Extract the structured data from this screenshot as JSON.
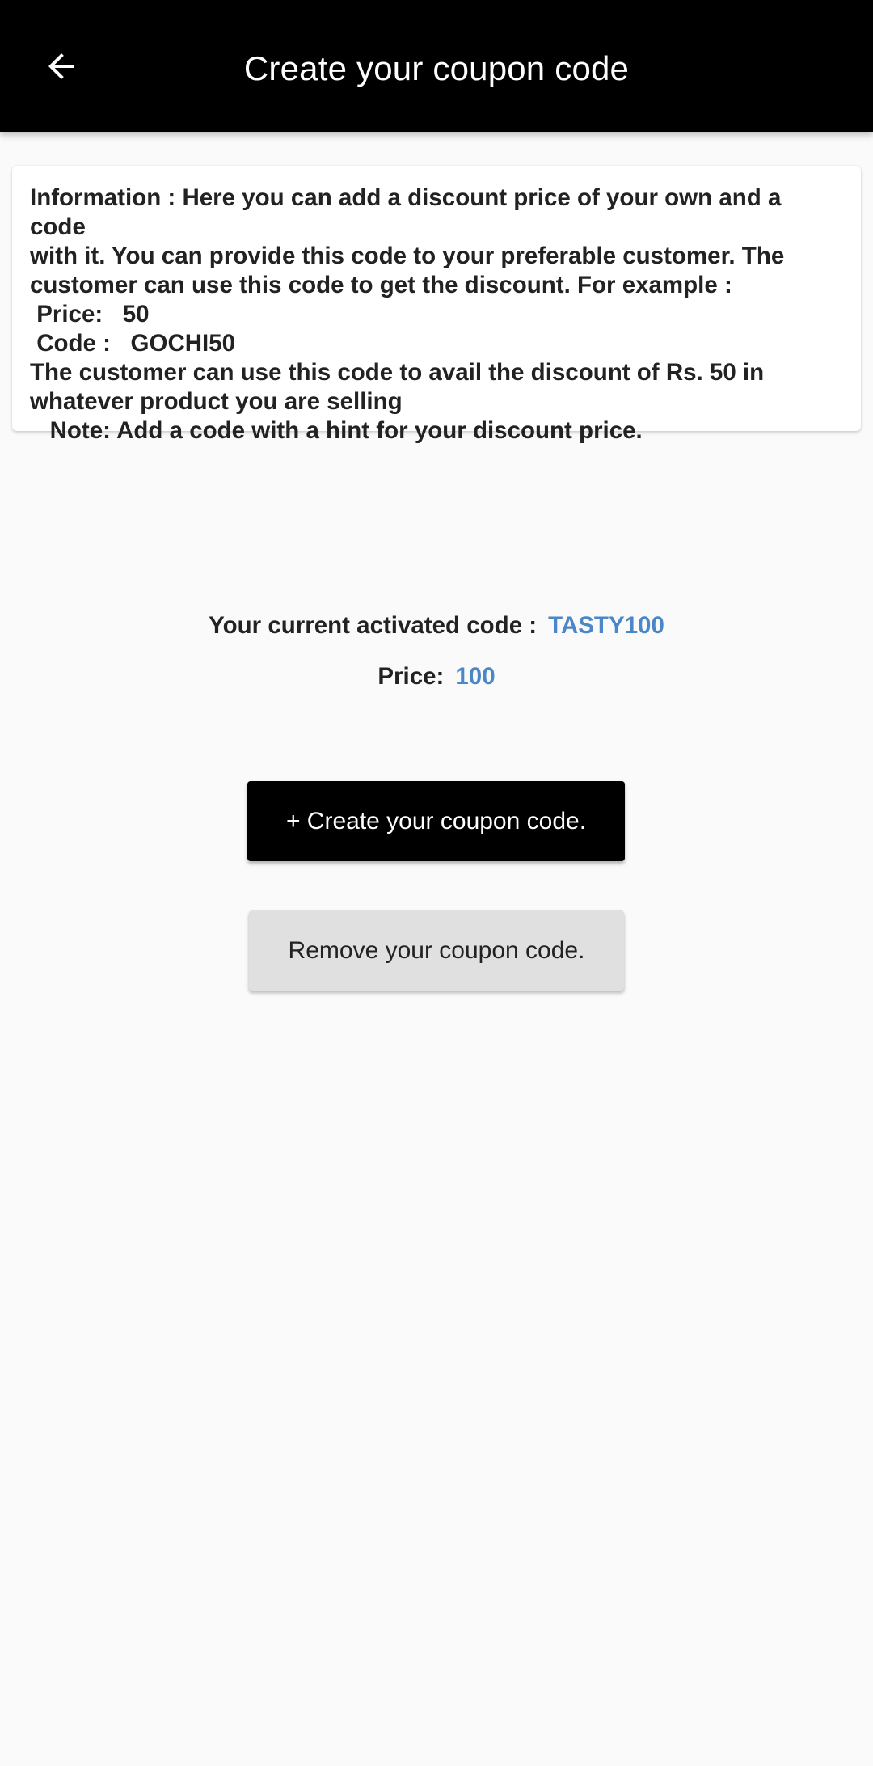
{
  "app_bar": {
    "title": "Create your coupon code",
    "back_icon": "arrow-left-icon"
  },
  "info_card": {
    "lines": [
      "Information : Here you can add a discount price of your own and a code",
      "with it. You can provide this code to your preferable customer. The",
      "customer can use this code to get the discount. For example :",
      " Price:   50",
      " Code :   GOCHI50",
      "The customer can use this code to avail the discount of Rs. 50 in",
      "whatever product you are selling",
      "   Note: Add a code with a hint for your discount price."
    ]
  },
  "current_code": {
    "label": "Your current activated code :",
    "value": "TASTY100"
  },
  "price": {
    "label": "Price:",
    "value": "100"
  },
  "buttons": {
    "create_label": "+ Create your coupon code.",
    "remove_label": "Remove your coupon code."
  },
  "colors": {
    "app_bar": "#000000",
    "background": "#fafafa",
    "accent_value": "#4a86c8",
    "create_button": "#000000",
    "remove_button": "#e0e0e0"
  }
}
